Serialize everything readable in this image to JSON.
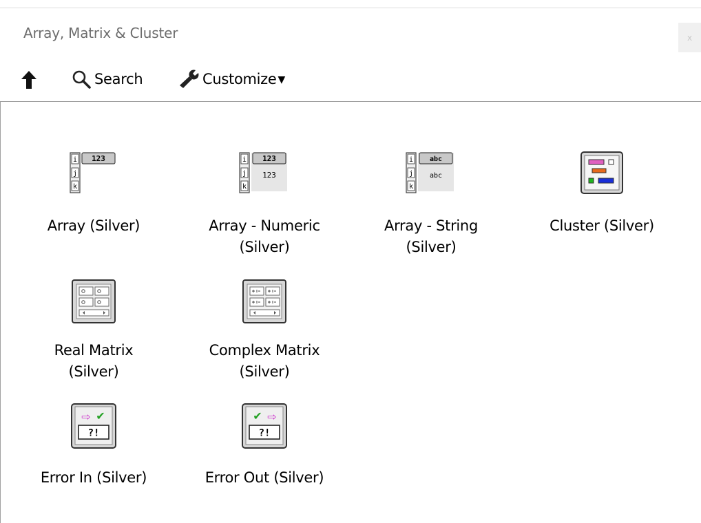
{
  "window": {
    "title": "Array, Matrix & Cluster",
    "close_label": "x"
  },
  "toolbar": {
    "up_icon": "up-arrow-icon",
    "search_label": "Search",
    "customize_label": "Customize",
    "customize_caret": "▼"
  },
  "palette": {
    "items": [
      {
        "label": "Array (Silver)",
        "icon": "array-icon"
      },
      {
        "label": "Array - Numeric\n(Silver)",
        "icon": "array-numeric-icon"
      },
      {
        "label": "Array - String\n(Silver)",
        "icon": "array-string-icon"
      },
      {
        "label": "Cluster (Silver)",
        "icon": "cluster-icon"
      },
      {
        "label": "Real Matrix\n(Silver)",
        "icon": "real-matrix-icon"
      },
      {
        "label": "Complex Matrix\n(Silver)",
        "icon": "complex-matrix-icon"
      },
      {
        "label": "Error In  (Silver)",
        "icon": "error-in-icon"
      },
      {
        "label": "Error Out (Silver)",
        "icon": "error-out-icon"
      }
    ],
    "glyphs": {
      "i": "i",
      "j": "j",
      "k": "k",
      "num": "123",
      "abc": "abc",
      "err": "?!",
      "arrow": "⇨",
      "check": "✔"
    }
  }
}
